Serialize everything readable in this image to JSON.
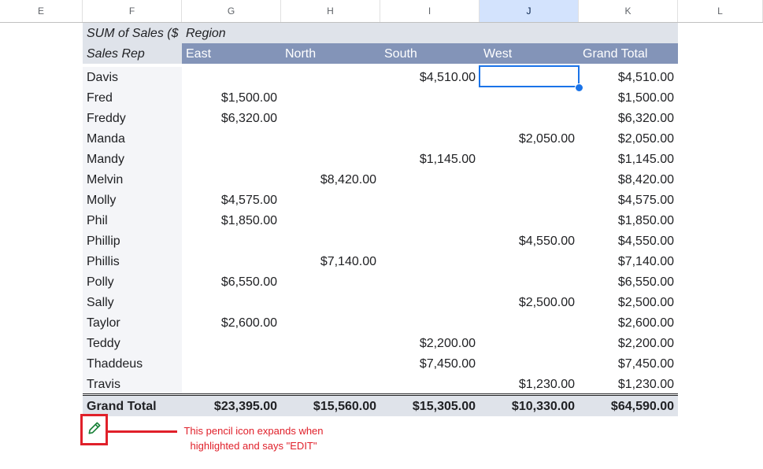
{
  "columns": [
    "E",
    "F",
    "G",
    "H",
    "I",
    "J",
    "K",
    "L"
  ],
  "selected_column": "J",
  "pivot": {
    "title": "SUM of Sales ($",
    "column_field": "Region",
    "row_field": "Sales Rep",
    "regions": [
      "East",
      "North",
      "South",
      "West",
      "Grand Total"
    ],
    "rows": [
      {
        "rep": "Davis",
        "East": "",
        "North": "",
        "South": "$4,510.00",
        "West": "",
        "Total": "$4,510.00"
      },
      {
        "rep": "Fred",
        "East": "$1,500.00",
        "North": "",
        "South": "",
        "West": "",
        "Total": "$1,500.00"
      },
      {
        "rep": "Freddy",
        "East": "$6,320.00",
        "North": "",
        "South": "",
        "West": "",
        "Total": "$6,320.00"
      },
      {
        "rep": "Manda",
        "East": "",
        "North": "",
        "South": "",
        "West": "$2,050.00",
        "Total": "$2,050.00"
      },
      {
        "rep": "Mandy",
        "East": "",
        "North": "",
        "South": "$1,145.00",
        "West": "",
        "Total": "$1,145.00"
      },
      {
        "rep": "Melvin",
        "East": "",
        "North": "$8,420.00",
        "South": "",
        "West": "",
        "Total": "$8,420.00"
      },
      {
        "rep": "Molly",
        "East": "$4,575.00",
        "North": "",
        "South": "",
        "West": "",
        "Total": "$4,575.00"
      },
      {
        "rep": "Phil",
        "East": "$1,850.00",
        "North": "",
        "South": "",
        "West": "",
        "Total": "$1,850.00"
      },
      {
        "rep": "Phillip",
        "East": "",
        "North": "",
        "South": "",
        "West": "$4,550.00",
        "Total": "$4,550.00"
      },
      {
        "rep": "Phillis",
        "East": "",
        "North": "$7,140.00",
        "South": "",
        "West": "",
        "Total": "$7,140.00"
      },
      {
        "rep": "Polly",
        "East": "$6,550.00",
        "North": "",
        "South": "",
        "West": "",
        "Total": "$6,550.00"
      },
      {
        "rep": "Sally",
        "East": "",
        "North": "",
        "South": "",
        "West": "$2,500.00",
        "Total": "$2,500.00"
      },
      {
        "rep": "Taylor",
        "East": "$2,600.00",
        "North": "",
        "South": "",
        "West": "",
        "Total": "$2,600.00"
      },
      {
        "rep": "Teddy",
        "East": "",
        "North": "",
        "South": "$2,200.00",
        "West": "",
        "Total": "$2,200.00"
      },
      {
        "rep": "Thaddeus",
        "East": "",
        "North": "",
        "South": "$7,450.00",
        "West": "",
        "Total": "$7,450.00"
      },
      {
        "rep": "Travis",
        "East": "",
        "North": "",
        "South": "",
        "West": "$1,230.00",
        "Total": "$1,230.00"
      }
    ],
    "grand_total": {
      "label": "Grand Total",
      "East": "$23,395.00",
      "North": "$15,560.00",
      "South": "$15,305.00",
      "West": "$10,330.00",
      "Total": "$64,590.00"
    }
  },
  "edit_button": {
    "icon": "pencil-icon"
  },
  "annotation": {
    "text": "This pencil icon expands when highlighted and says \"EDIT\""
  },
  "colors": {
    "header_blue": "#8394b8",
    "header_light": "#dfe3ea",
    "selection": "#1a73e8",
    "annotation_red": "#e0202a"
  }
}
